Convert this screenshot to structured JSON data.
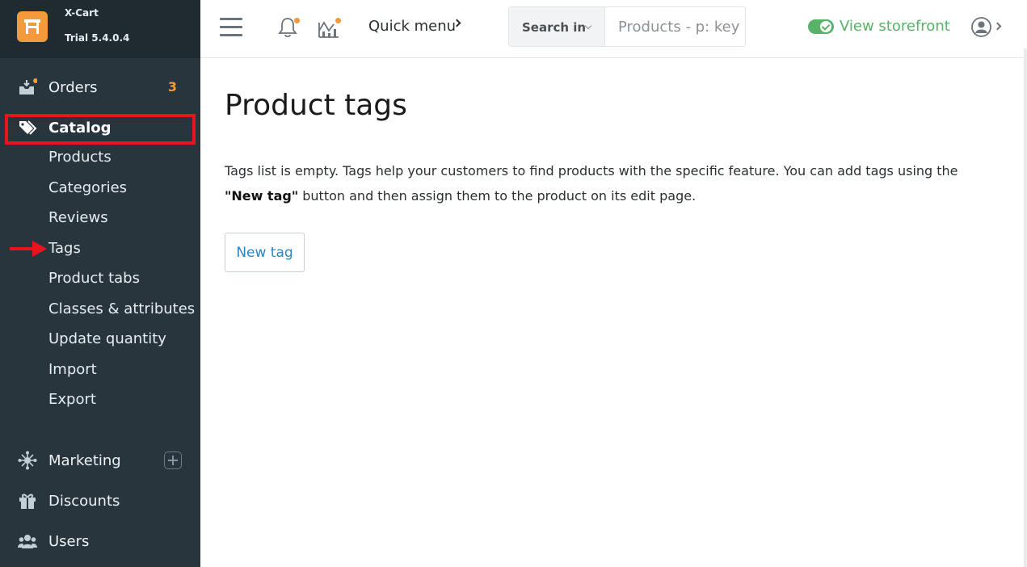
{
  "brand": {
    "name": "X-Cart",
    "version": "Trial 5.4.0.4"
  },
  "sidebar": {
    "orders": {
      "label": "Orders",
      "count": "3"
    },
    "catalog": {
      "label": "Catalog",
      "items": [
        "Products",
        "Categories",
        "Reviews",
        "Tags",
        "Product tabs",
        "Classes & attributes",
        "Update quantity",
        "Import",
        "Export"
      ]
    },
    "marketing": {
      "label": "Marketing"
    },
    "discounts": {
      "label": "Discounts"
    },
    "users": {
      "label": "Users"
    }
  },
  "topbar": {
    "quick_menu": "Quick menu",
    "search_in_label": "Search in",
    "search_placeholder": "Products - p: key",
    "storefront_label": "View storefront"
  },
  "main": {
    "title": "Product tags",
    "description_1": "Tags list is empty. Tags help your customers to find products with the specific feature. You can add tags using the ",
    "description_bold": "\"New tag\"",
    "description_2": " button and then assign them to the product on its edit page.",
    "new_tag_button": "New tag"
  },
  "colors": {
    "accent": "#f39a3c",
    "sidebar_bg": "#28353d",
    "link": "#2a86c4",
    "success": "#58b368",
    "highlight": "#e9141d"
  },
  "icons": [
    "logo-icon",
    "orders-icon",
    "tag-icon",
    "marketing-icon",
    "discounts-icon",
    "users-icon",
    "hamburger-icon",
    "bell-icon",
    "chart-icon",
    "user-icon"
  ]
}
